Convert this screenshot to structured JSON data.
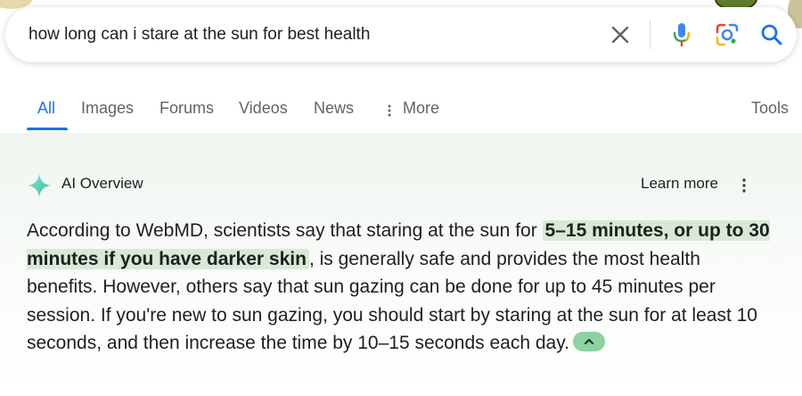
{
  "search": {
    "query": "how long can i stare at the sun for best health"
  },
  "tabs": [
    {
      "label": "All",
      "active": true
    },
    {
      "label": "Images"
    },
    {
      "label": "Forums"
    },
    {
      "label": "Videos"
    },
    {
      "label": "News"
    },
    {
      "label": "More"
    }
  ],
  "tools_label": "Tools",
  "ai_overview": {
    "title": "AI Overview",
    "learn_more": "Learn more",
    "text_before": "According to WebMD, scientists say that staring at the sun for ",
    "highlight": "5–15 minutes, or up to 30 minutes if you have darker skin",
    "text_after": ", is generally safe and provides the most health benefits. However, others say that sun gazing can be done for up to 45 minutes per session. If you're new to sun gazing, you should start by staring at the sun for at least 10 seconds, and then increase the time by 10–15 seconds each day."
  },
  "colors": {
    "accent": "#1a73e8",
    "highlight_bg": "#d8ead7",
    "panel_bg": "#eff5ef",
    "collapse_button": "#8cd3a1"
  },
  "icons": {
    "clear": "close-icon",
    "mic": "microphone-icon",
    "lens": "google-lens-icon",
    "search": "search-icon",
    "more": "vertical-dots-icon",
    "ai": "sparkle-icon",
    "collapse": "chevron-up-icon"
  }
}
